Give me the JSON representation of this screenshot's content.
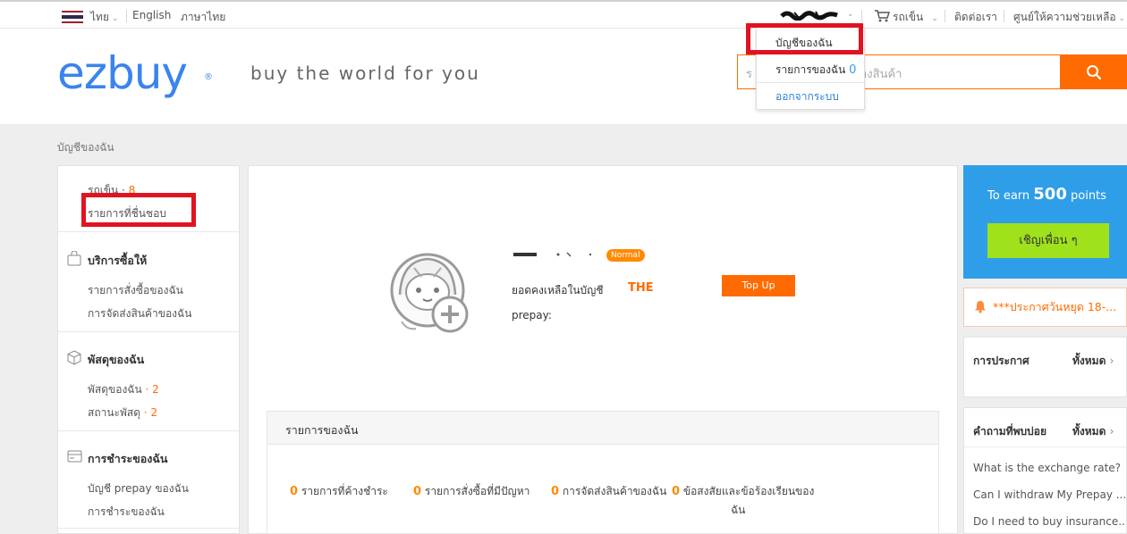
{
  "topbar": {
    "language_current": "ไทย",
    "lang_english": "English",
    "lang_thai": "ภาษาไทย",
    "cart_label": "รถเข็น",
    "contact_label": "ติดต่อเรา",
    "help_label": "ศูนย์ให้ความช่วยเหลือ"
  },
  "account_menu": {
    "items": [
      {
        "label": "บัญชีของฉัน"
      },
      {
        "label": "รายการของฉัน",
        "count": "0"
      },
      {
        "label": "ออกจากระบบ"
      }
    ]
  },
  "header": {
    "logo_text": "ezbuy",
    "logo_mark": "®",
    "tagline": "buy the world for you",
    "search_placeholder": "ร",
    "search_placeholder_tail": "างสินค้า"
  },
  "breadcrumb": "บัญชีของฉัน",
  "sidebar": {
    "cart_label": "รถเข็น",
    "cart_count": "8",
    "wishlist_label": "รายการที่ชื่นชอบ",
    "sections": [
      {
        "title": "บริการซื้อให้",
        "icon": "shopping-bag-icon",
        "items": [
          {
            "label": "รายการสั่งซื้อของฉัน",
            "count": ""
          },
          {
            "label": "การจัดส่งสินค้าของฉัน",
            "count": ""
          }
        ]
      },
      {
        "title": "พัสดุของฉัน",
        "icon": "package-box-icon",
        "items": [
          {
            "label": "พัสดุของฉัน",
            "count": "2"
          },
          {
            "label": "สถานะพัสดุ",
            "count": "2"
          }
        ]
      },
      {
        "title": "การชำระของฉัน",
        "icon": "credit-card-icon",
        "items": [
          {
            "label": "บัญชี prepay ของฉัน",
            "count": ""
          },
          {
            "label": "การชำระของฉัน",
            "count": ""
          }
        ]
      }
    ]
  },
  "profile": {
    "level_badge": "Normal",
    "balance_label": "ยอดคงเหลือในบัญชี",
    "balance_currency": "THE",
    "balance_sub_label": "prepay:",
    "topup_label": "Top Up"
  },
  "orders": {
    "title": "รายการของฉัน",
    "stats": [
      {
        "count": "0",
        "label": "รายการที่ค้างชำระ"
      },
      {
        "count": "0",
        "label": "รายการสั่งซื้อที่มีปัญหา"
      },
      {
        "count": "0",
        "label": "การจัดส่งสินค้าของฉัน"
      },
      {
        "count": "0",
        "label": "ข้อสงสัยและข้อร้องเรียนของ",
        "label2": "ฉัน"
      }
    ]
  },
  "promo": {
    "earn_prefix": "To earn",
    "points_value": "500",
    "points_suffix": "points",
    "invite_label": "เชิญเพื่อน ๆ"
  },
  "notice": {
    "text": "***ประกาศวันหยุด 18-..."
  },
  "announcements": {
    "title": "การประกาศ",
    "all_label": "ทั้งหมด"
  },
  "faq": {
    "title": "คำถามที่พบบ่อย",
    "all_label": "ทั้งหมด",
    "items": [
      "What is the exchange rate?",
      "Can I withdraw My Prepay ...",
      "Do I need to buy insurance..."
    ]
  },
  "colors": {
    "brand_blue": "#3a84ee",
    "accent_orange": "#ff6b00",
    "highlight_red": "#e21321",
    "invite_green": "#9fe21b",
    "promo_blue": "#2f9ee8"
  }
}
